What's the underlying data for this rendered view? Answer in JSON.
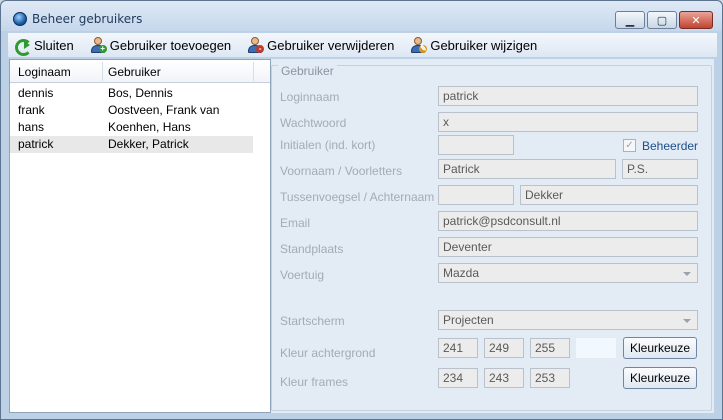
{
  "window": {
    "title": "Beheer gebruikers"
  },
  "toolbar": {
    "sluiten": "Sluiten",
    "toevoegen": "Gebruiker toevoegen",
    "verwijderen": "Gebruiker verwijderen",
    "wijzigen": "Gebruiker wijzigen"
  },
  "list": {
    "headers": [
      "Loginaam",
      "Gebruiker"
    ],
    "rows": [
      {
        "login": "dennis",
        "name": "Bos, Dennis"
      },
      {
        "login": "frank",
        "name": "Oostveen, Frank van"
      },
      {
        "login": "hans",
        "name": "Koenhen, Hans"
      },
      {
        "login": "patrick",
        "name": "Dekker, Patrick"
      }
    ],
    "selected_index": 3
  },
  "detail": {
    "group_title": "Gebruiker",
    "labels": {
      "loginnaam": "Loginnaam",
      "wachtwoord": "Wachtwoord",
      "initialen": "Initialen (ind. kort)",
      "voornaam": "Voornaam / Voorletters",
      "tussenvoegsel": "Tussenvoegsel / Achternaam",
      "email": "Email",
      "standplaats": "Standplaats",
      "voertuig": "Voertuig",
      "startscherm": "Startscherm",
      "kleur_achtergrond": "Kleur achtergrond",
      "kleur_frames": "Kleur frames"
    },
    "values": {
      "loginnaam": "patrick",
      "wachtwoord": "x",
      "initialen": "",
      "voornaam": "Patrick",
      "voorletters": "P.S.",
      "tussenvoegsel": "",
      "achternaam": "Dekker",
      "email": "patrick@psdconsult.nl",
      "standplaats": "Deventer",
      "voertuig": "Mazda",
      "startscherm": "Projecten",
      "bg_r": "241",
      "bg_g": "249",
      "bg_b": "255",
      "fr_r": "234",
      "fr_g": "243",
      "fr_b": "253"
    },
    "beheerder": {
      "label": "Beheerder",
      "checked": true,
      "mark": "✓"
    },
    "kleurkeuze": "Kleurkeuze",
    "colors": {
      "bg_swatch": "#f1f9ff"
    }
  },
  "icons": {
    "window_close": "✕",
    "window_maximize": "▢",
    "window_minimize": "▁"
  }
}
